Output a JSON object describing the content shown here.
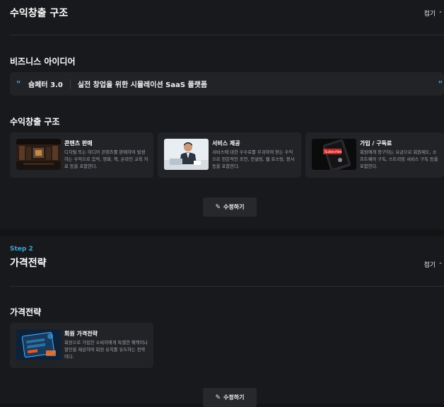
{
  "colors": {
    "background": "#131416",
    "panel": "#18191c",
    "card": "#222327",
    "accent": "#3aa5d4",
    "muted_text": "#a6a7ad"
  },
  "collapse_label": "접기",
  "section1": {
    "title": "수익창출 구조",
    "business_idea": {
      "heading": "비즈니스 아이디어",
      "name": "슘페터 3.0",
      "description": "실전 창업을 위한 시뮬레이션 SaaS 플랫폼"
    },
    "revenue": {
      "heading": "수익창출 구조",
      "cards": [
        {
          "title": "콘텐츠 판매",
          "description": "디지털 또는 미디어 콘텐츠를 판매하여 발생하는 수익으로 음악, 영화, 책, 온라인 교육 자료 등을 포함한다.",
          "image": "media-library-image"
        },
        {
          "title": "서비스 제공",
          "description": "서비스에 대한 수수료를 부과하여 얻는 수익으로 전문적인 조언, 컨설팅, 웹 호스팅, 봉사 등을 포함한다.",
          "image": "businessman-laptop-image"
        },
        {
          "title": "가입 / 구독료",
          "description": "회원에게 청구하는 요금으로 회원제도, 소프트웨어 구독, 스트리밍 서비스 구독 등을 포함한다.",
          "image": "subscribe-phone-image"
        }
      ]
    },
    "edit_label": "수정하기"
  },
  "section2": {
    "step": "Step 2",
    "title": "가격전략",
    "heading": "가격전략",
    "cards": [
      {
        "title": "회원 가격전략",
        "description": "회원으로 가입한 소비자에게 특별한 혜택이나 할인을 제공하여 회원 유치를 유도하는 전략이다.",
        "image": "login-screen-image"
      }
    ],
    "edit_label": "수정하기"
  }
}
